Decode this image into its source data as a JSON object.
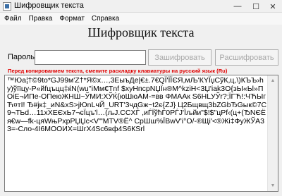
{
  "window": {
    "title": "Шифровщик текста",
    "minimize": "—",
    "maximize": "☐",
    "close": "✕"
  },
  "menu": {
    "items": [
      "Файл",
      "Правка",
      "Формат",
      "Справка"
    ]
  },
  "main": {
    "heading": "Шифровщик текста",
    "password_label": "Пароль:",
    "password_value": "",
    "encrypt_button": "Зашифровать",
    "decrypt_button": "Расшифровать",
    "warning": "Перед копированием текста, смените раскладку клавиатуры на русский язык (Ru)",
    "text": "™Юa¦†©9to*GJ99м'Z†*Я©х…,3ЕыъДе|€±.7€QЇ'ЇЇЄЯ,мЉ'КYЇџСўК,ц,\\)КЪЪ›hy)ўїїцу-Р«йfцъцц‡ќN(wu''iМм€Тnf $хуНпсрNЏЇн®М^kziН<3Џ'iak3О{зЫ«Ьl»П ОіЕ¬ИПе-ОПеюЖНШ~ЎМИ:ХЎЌ{юШюАМ-=вв ФМААк S6НLУЎr?;ЇГЋ!:ЧЋЫгЋ¤тІ! Ђ#јк‡_иN&xS>јЮnLчЙ_URT'3чдGж~t2є{ZJ} Ц2Бщвщ3bZGbЂGык©7С9¬ТЬd…11xХЕЄхЬ7¬єЇцъ'l…(љJ.CCXЃ ,иЃЇўћЃ0РЃЈ'Їљйи\"$!$\"цРf‹(ц+(ЂNЄЁя€w—fk-цяWњРхрРЏЏс<V'\"МТV®Ё^ СрШш%ЇВwV'i°О/-®Щі'<®Жі‡ФуЖЎА33=-Сло-4І6МООИХ=ШгХ4Sс6вф4S6КSrl"
  }
}
